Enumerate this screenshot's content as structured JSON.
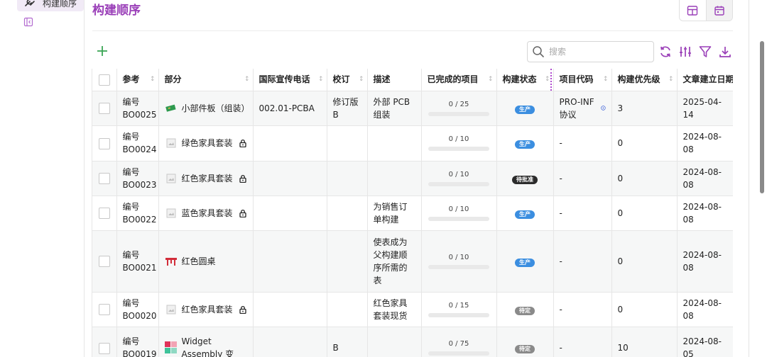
{
  "sidebar": {
    "active_item_label": "构建顺序",
    "active_icon": "tools-icon",
    "collapse_icon": "sidebar-collapse-icon"
  },
  "header": {
    "title": "构建顺序",
    "view_table_icon": "table-icon",
    "view_calendar_icon": "calendar-icon"
  },
  "toolbar": {
    "search_placeholder": "搜索",
    "icons": [
      "refresh-icon",
      "sliders-icon",
      "filter-icon",
      "download-icon"
    ]
  },
  "colors": {
    "accent": "#9a3fb8",
    "add": "#3aa655",
    "badge_production": "#3b8ee0",
    "badge_pending_approval": "#2b2b2b",
    "badge_pending": "#8a8a8a"
  },
  "table": {
    "columns": [
      "参考",
      "部分",
      "国际宣传电话",
      "校订",
      "描述",
      "已完成的项目",
      "构建状态",
      "项目代码",
      "构建优先级",
      "文章建立日期"
    ],
    "rows": [
      {
        "ref": "编号 BO0025",
        "part": "小部件板（组装）",
        "part_icon": "pcb-icon",
        "locked": false,
        "ipn": "002.01-PCBA",
        "rev": "修订版 B",
        "desc": "外部 PCB 组装",
        "progress": "0 / 25",
        "completed_fraction": 0,
        "status": "生产",
        "status_kind": "production",
        "project_code": "PRO-INF 协议",
        "has_info": true,
        "priority": "3",
        "date": "2025-04-14"
      },
      {
        "ref": "编号 BO0024",
        "part": "绿色家具套装",
        "part_icon": "image-placeholder-icon",
        "locked": true,
        "ipn": "",
        "rev": "",
        "desc": "",
        "progress": "0 / 10",
        "completed_fraction": 0,
        "status": "生产",
        "status_kind": "production",
        "project_code": "-",
        "has_info": false,
        "priority": "0",
        "date": "2024-08-08"
      },
      {
        "ref": "编号 BO0023",
        "part": "红色家具套装",
        "part_icon": "image-placeholder-icon",
        "locked": true,
        "ipn": "",
        "rev": "",
        "desc": "",
        "progress": "0 / 10",
        "completed_fraction": 0,
        "status": "待批准",
        "status_kind": "pending_approval",
        "project_code": "-",
        "has_info": false,
        "priority": "0",
        "date": "2024-08-08"
      },
      {
        "ref": "编号 BO0022",
        "part": "蓝色家具套装",
        "part_icon": "image-placeholder-icon",
        "locked": true,
        "ipn": "",
        "rev": "",
        "desc": "为销售订单构建",
        "progress": "0 / 10",
        "completed_fraction": 0,
        "status": "生产",
        "status_kind": "production",
        "project_code": "-",
        "has_info": false,
        "priority": "0",
        "date": "2024-08-08"
      },
      {
        "ref": "编号 BO0021",
        "part": "红色圆桌",
        "part_icon": "red-table-icon",
        "locked": false,
        "ipn": "",
        "rev": "",
        "desc": "使表成为父构建顺序所需的表",
        "progress": "0 / 10",
        "completed_fraction": 0,
        "status": "生产",
        "status_kind": "production",
        "project_code": "-",
        "has_info": false,
        "priority": "0",
        "date": "2024-08-08"
      },
      {
        "ref": "编号 BO0020",
        "part": "红色家具套装",
        "part_icon": "image-placeholder-icon",
        "locked": true,
        "ipn": "",
        "rev": "",
        "desc": "红色家具套装现货",
        "progress": "0 / 15",
        "completed_fraction": 0,
        "status": "待定",
        "status_kind": "pending",
        "project_code": "-",
        "has_info": false,
        "priority": "0",
        "date": "2024-08-08"
      },
      {
        "ref": "编号 BO0019",
        "part": "Widget Assembly 变",
        "part_icon": "widget-assembly-icon",
        "locked": false,
        "ipn": "",
        "rev": "B",
        "desc": "",
        "progress": "0 / 75",
        "completed_fraction": 0,
        "status": "待定",
        "status_kind": "pending",
        "project_code": "-",
        "has_info": false,
        "priority": "10",
        "date": "2024-08-05"
      }
    ]
  }
}
